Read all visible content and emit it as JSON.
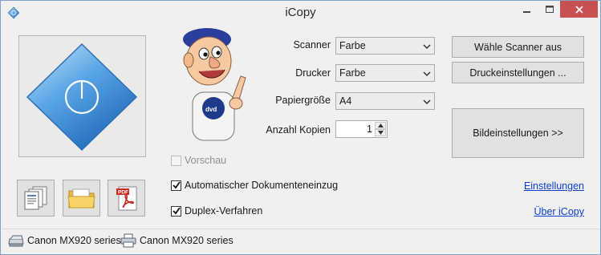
{
  "window": {
    "title": "iCopy"
  },
  "labels": {
    "scanner": "Scanner",
    "drucker": "Drucker",
    "papiergroesse": "Papiergröße",
    "anzahl_kopien": "Anzahl Kopien"
  },
  "combos": {
    "scanner_value": "Farbe",
    "drucker_value": "Farbe",
    "papier_value": "A4"
  },
  "spinner": {
    "kopien_value": "1"
  },
  "buttons": {
    "waehle_scanner": "Wähle Scanner aus",
    "druckeinstellungen": "Druckeinstellungen ...",
    "bildeinstellungen": "Bildeinstellungen >>"
  },
  "checkboxes": {
    "vorschau": {
      "label": "Vorschau",
      "checked": false,
      "enabled": false
    },
    "auto_dokument": {
      "label": "Automatischer Dokumenteneinzug",
      "checked": true
    },
    "duplex": {
      "label": "Duplex-Verfahren",
      "checked": true
    }
  },
  "links": {
    "einstellungen": "Einstellungen",
    "ueber": "Über iCopy"
  },
  "status": {
    "scanner_device": "Canon MX920 series",
    "printer_device": "Canon MX920 series"
  },
  "icons": {
    "app": "diamond-app-icon",
    "copy_button": "documents-stack-icon",
    "folder_button": "folder-icon",
    "pdf_button": "pdf-icon"
  },
  "colors": {
    "close_button": "#c75050",
    "diamond_blue": "#2f7fd0",
    "link": "#0b3fd8"
  }
}
